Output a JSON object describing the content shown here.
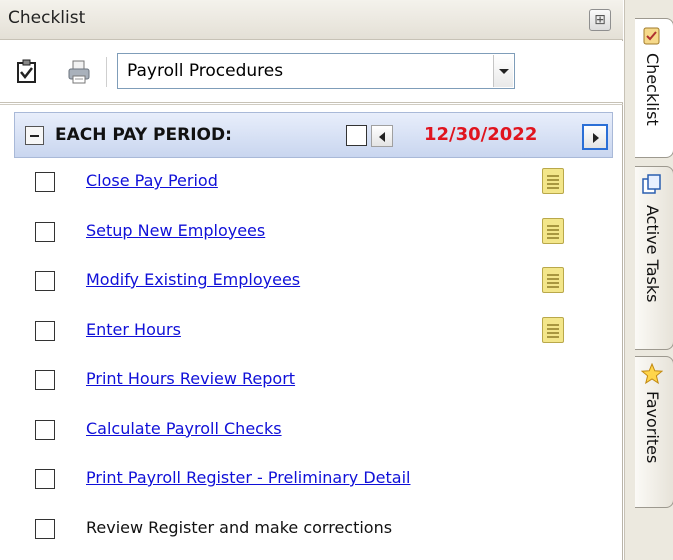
{
  "panel": {
    "title": "Checklist",
    "pin_glyph": "⊞"
  },
  "toolbar": {
    "checklist_icon": "checklist-icon",
    "print_icon": "printer-icon",
    "procedure_selected": "Payroll Procedures"
  },
  "section": {
    "title": "EACH PAY PERIOD:",
    "date": "12/30/2022",
    "date_color": "#e0141e"
  },
  "tasks": [
    {
      "label": "Close Pay Period",
      "link": true,
      "note": true
    },
    {
      "label": "Setup New Employees",
      "link": true,
      "note": true
    },
    {
      "label": "Modify Existing Employees",
      "link": true,
      "note": true
    },
    {
      "label": "Enter Hours",
      "link": true,
      "note": true
    },
    {
      "label": "Print Hours Review Report",
      "link": true,
      "note": false
    },
    {
      "label": "Calculate Payroll Checks",
      "link": true,
      "note": false
    },
    {
      "label": "Print Payroll Register - Preliminary Detail",
      "link": true,
      "note": false
    },
    {
      "label": "Review Register and make corrections",
      "link": false,
      "note": false
    }
  ],
  "side_tabs": [
    {
      "label": "Checklist",
      "icon": "checklist-tab-icon",
      "active": true
    },
    {
      "label": "Active Tasks",
      "icon": "tasks-tab-icon",
      "active": false
    },
    {
      "label": "Favorites",
      "icon": "star-icon",
      "active": false
    }
  ],
  "colors": {
    "link": "#1010d8",
    "header_gradient_top": "#e8eefb",
    "header_gradient_bottom": "#c9d6ef"
  }
}
